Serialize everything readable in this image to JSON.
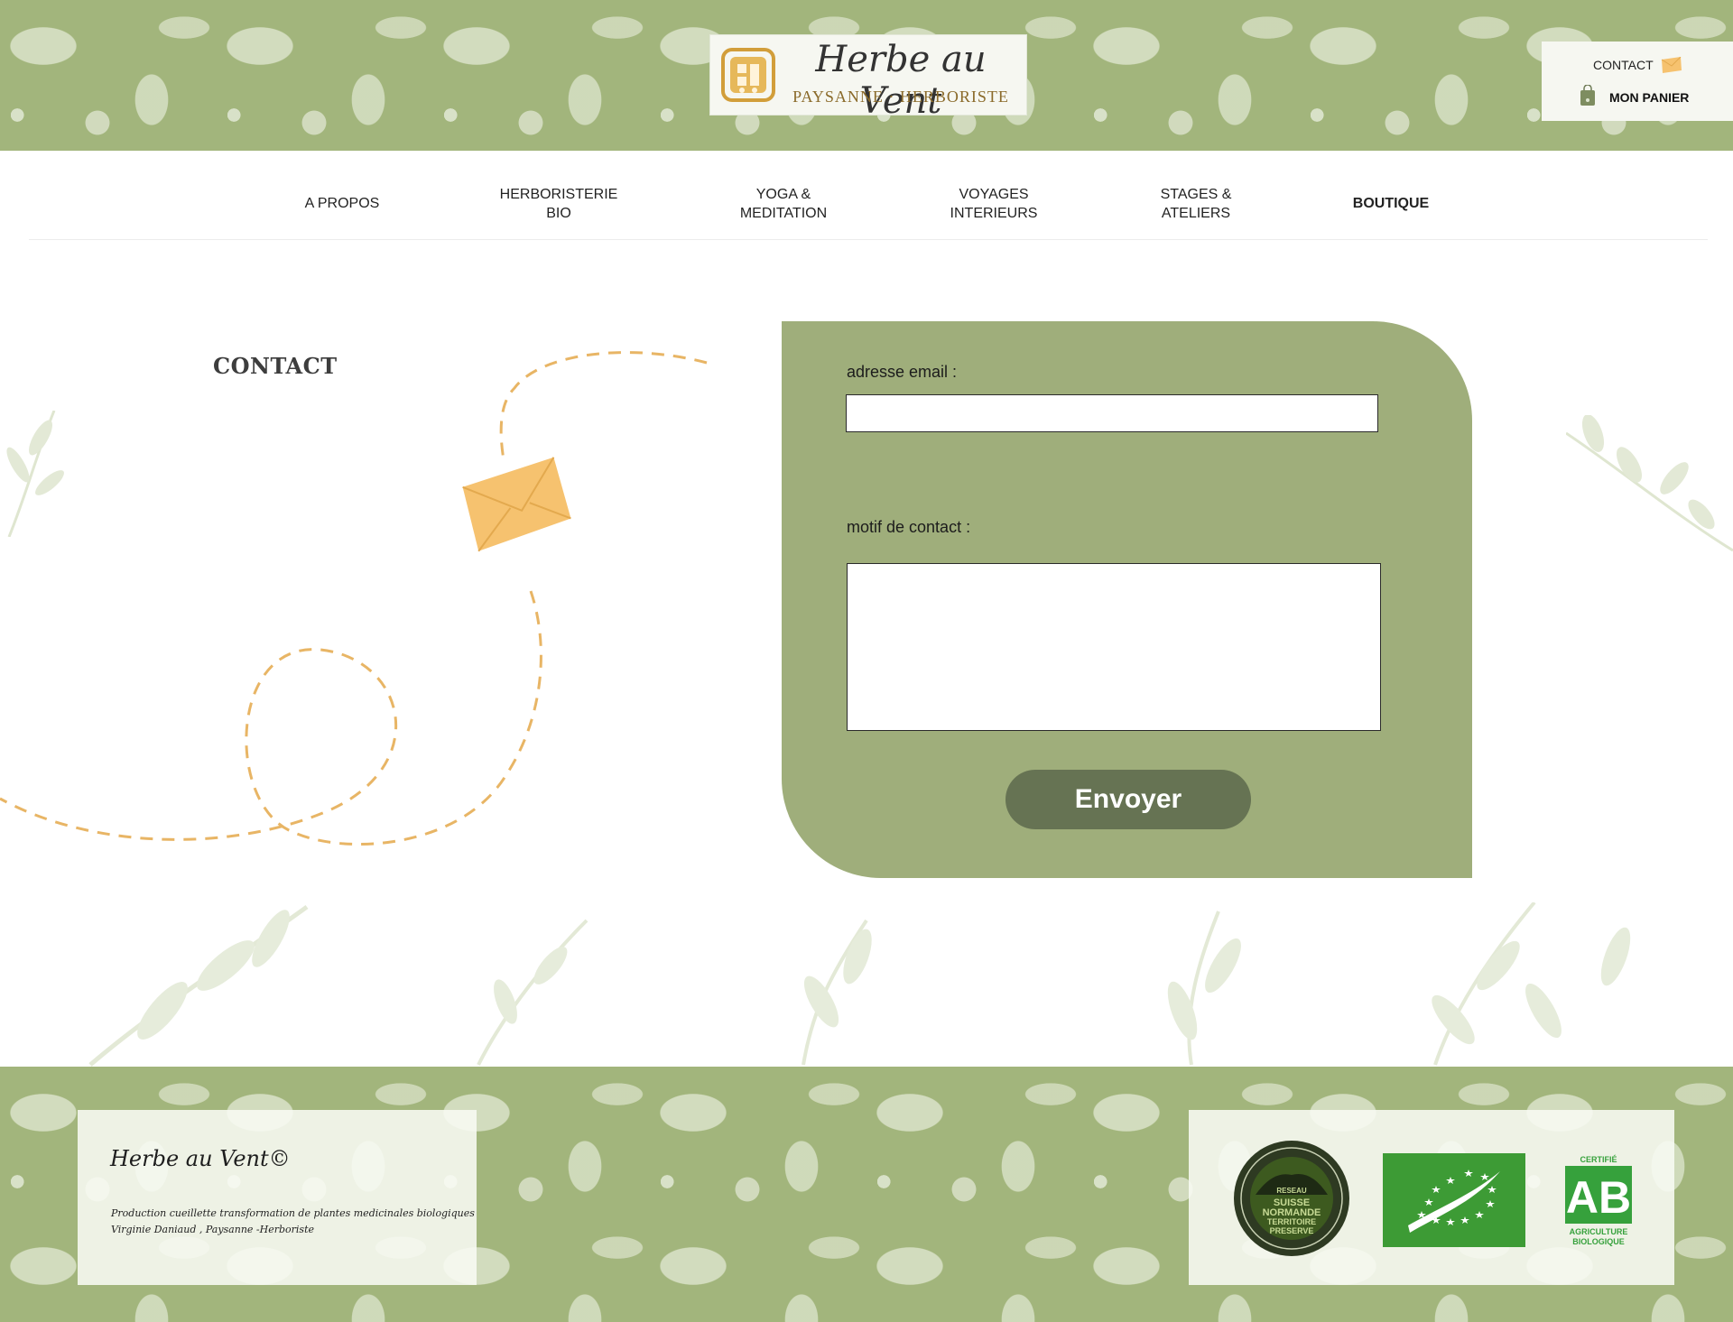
{
  "header": {
    "logo_name": "Herbe au Vent",
    "logo_tagline": "PAYSANNE · HERBORISTE",
    "contact_link": "CONTACT",
    "cart_link": "MON PANIER"
  },
  "nav": {
    "items": [
      {
        "line1": "A PROPOS",
        "line2": ""
      },
      {
        "line1": "HERBORISTERIE",
        "line2": "BIO"
      },
      {
        "line1": "YOGA &",
        "line2": "MEDITATION"
      },
      {
        "line1": "VOYAGES",
        "line2": "INTERIEURS"
      },
      {
        "line1": "STAGES &",
        "line2": "ATELIERS"
      },
      {
        "line1": "BOUTIQUE",
        "line2": ""
      }
    ]
  },
  "contact": {
    "title": "CONTACT",
    "email_label": "adresse email :",
    "email_value": "",
    "motif_label": "motif de contact :",
    "motif_value": "",
    "submit_label": "Envoyer"
  },
  "footer": {
    "brand": "Herbe au Vent©",
    "line1": "Production cueillette transformation de plantes medicinales biologiques",
    "line2": "Virginie Daniaud , Paysanne -Herboriste",
    "seal_network_top": "RESEAU",
    "seal_network_lines": [
      "SUISSE",
      "NORMANDE",
      "TERRITOIRE",
      "PRESERVE"
    ],
    "ab_certified": "CERTIFIÉ",
    "ab_letters": "AB",
    "ab_bottom1": "AGRICULTURE",
    "ab_bottom2": "BIOLOGIQUE"
  },
  "colors": {
    "damask_green": "#a2b57c",
    "form_green": "#9fae7b",
    "button_green": "#667353",
    "envelope_yellow": "#f6c26f",
    "dash_orange": "#e8b565"
  }
}
